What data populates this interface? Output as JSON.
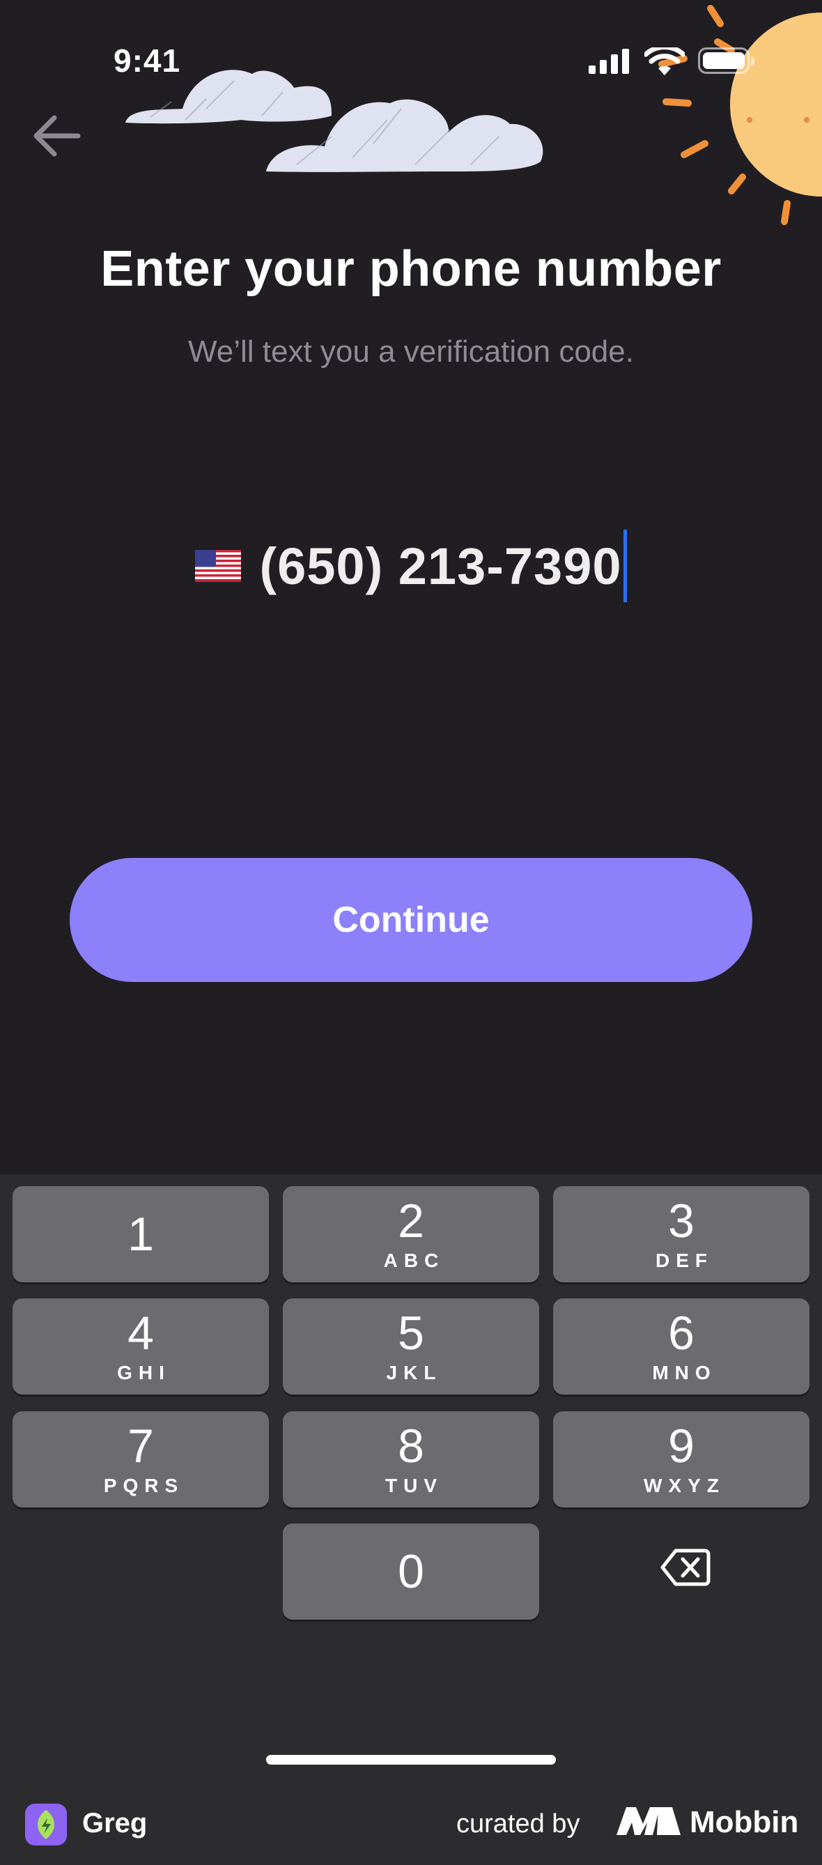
{
  "status_bar": {
    "time": "9:41"
  },
  "header": {
    "title": "Enter your phone number",
    "subtitle": "We’ll text you a verification code."
  },
  "phone_input": {
    "country_flag": "us-flag-icon",
    "value": "(650) 213-7390"
  },
  "continue_label": "Continue",
  "keypad": {
    "keys": [
      {
        "num": "1",
        "letters": ""
      },
      {
        "num": "2",
        "letters": "ABC"
      },
      {
        "num": "3",
        "letters": "DEF"
      },
      {
        "num": "4",
        "letters": "GHI"
      },
      {
        "num": "5",
        "letters": "JKL"
      },
      {
        "num": "6",
        "letters": "MNO"
      },
      {
        "num": "7",
        "letters": "PQRS"
      },
      {
        "num": "8",
        "letters": "TUV"
      },
      {
        "num": "9",
        "letters": "WXYZ"
      },
      {
        "num": "0",
        "letters": ""
      }
    ],
    "delete_icon": "backspace-icon"
  },
  "footer": {
    "app_name": "Greg",
    "curated_by": "curated by",
    "brand": "Mobbin"
  },
  "colors": {
    "background": "#201e23",
    "accent": "#8c80fb",
    "caret": "#2b6ff5",
    "key": "#6c6b70"
  }
}
